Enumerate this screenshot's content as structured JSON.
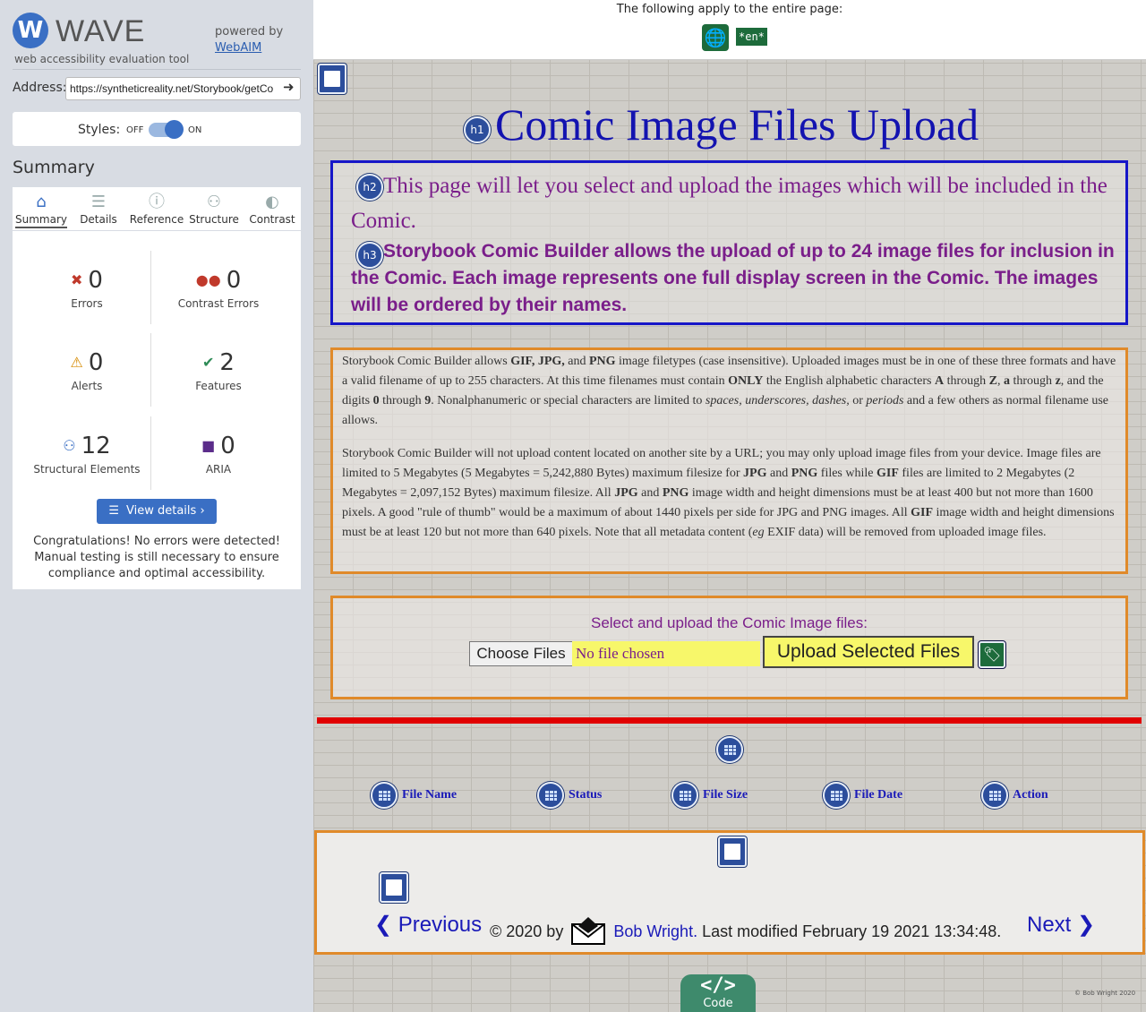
{
  "wave": {
    "logo_letter": "W",
    "logo_name": "WAVE",
    "tagline": "web accessibility evaluation tool",
    "powered_by": "powered by",
    "webaim": "WebAIM",
    "address_label": "Address:",
    "address_value": "https://syntheticreality.net/Storybook/getCo",
    "styles_label": "Styles:",
    "styles_off": "OFF",
    "styles_on": "ON",
    "styles_enabled": true,
    "summary_heading": "Summary",
    "tabs": [
      {
        "label": "Summary",
        "icon": "home-icon",
        "glyph": "⌂"
      },
      {
        "label": "Details",
        "icon": "list-icon",
        "glyph": "☰"
      },
      {
        "label": "Reference",
        "icon": "info-icon",
        "glyph": "ⓘ"
      },
      {
        "label": "Structure",
        "icon": "structure-icon",
        "glyph": "⚇"
      },
      {
        "label": "Contrast",
        "icon": "contrast-icon",
        "glyph": "◐"
      }
    ],
    "stats": {
      "errors": {
        "count": "0",
        "label": "Errors",
        "color": "#c0392b"
      },
      "contrast_errors": {
        "count": "0",
        "label": "Contrast Errors",
        "color": "#c0392b"
      },
      "alerts": {
        "count": "0",
        "label": "Alerts",
        "color": "#d68a00"
      },
      "features": {
        "count": "2",
        "label": "Features",
        "color": "#2e8b57"
      },
      "structural": {
        "count": "12",
        "label": "Structural Elements",
        "color": "#3a6fc4"
      },
      "aria": {
        "count": "0",
        "label": "ARIA",
        "color": "#5b2c8a"
      }
    },
    "view_details": "View details ›",
    "congrats": "Congratulations! No errors were detected! Manual testing is still necessary to ensure compliance and optimal accessibility."
  },
  "page": {
    "top_notice": "The following apply to the entire page:",
    "lang_badge": "*en*",
    "h1_badge": "h1",
    "h1": "Comic Image Files Upload",
    "h2_badge": "h2",
    "h2": "This page will let you select and upload the images which will be included in the Comic.",
    "h3_badge": "h3",
    "h3_pre": "Storybook Comic Builder allows the upload of up to ",
    "h3_num": "24",
    "h3_post": " image files for inclusion in the Comic. Each image represents one full display screen in the Comic. The images will be ordered by their names.",
    "para1": {
      "t1": "Storybook Comic Builder allows ",
      "b1": "GIF, JPG,",
      "t2": " and ",
      "b2": "PNG",
      "t3": " image filetypes (case insensitive). Uploaded images must be in one of these three formats and have a valid filename of up to 255 characters. At this time filenames must contain ",
      "b3": "ONLY",
      "t4": " the English alphabetic characters ",
      "b4": "A",
      "t5": " through ",
      "b5": "Z",
      "t6": ", ",
      "b6": "a",
      "t7": " through ",
      "b7": "z",
      "t8": ", and the digits ",
      "b8": "0",
      "t9": " through ",
      "b9": "9",
      "t10": ". Nonalphanumeric or special characters are limited to ",
      "i1": "spaces, underscores, dashes,",
      "t11": " or ",
      "i2": "periods",
      "t12": " and a few others as normal filename use allows."
    },
    "para2": {
      "t1": "Storybook Comic Builder will not upload content located on another site by a URL; you may only upload image files from your device. Image files are limited to 5 Megabytes (5 Megabytes = 5,242,880 Bytes) maximum filesize for ",
      "b1": "JPG",
      "t2": " and ",
      "b2": "PNG",
      "t3": " files while ",
      "b3": "GIF",
      "t4": " files are limited to 2 Megabytes (2 Megabytes = 2,097,152 Bytes) maximum filesize. All ",
      "b4": "JPG",
      "t5": " and ",
      "b5": "PNG",
      "t6": " image width and height dimensions must be at least 400 but not more than 1600 pixels. A good \"rule of thumb\" would be a maximum of about 1440 pixels per side for JPG and PNG images. All ",
      "b6": "GIF",
      "t7": " image width and height dimensions must be at least 120 but not more than 640 pixels. Note that all metadata content (",
      "i1": "eg",
      "t8": " EXIF data) will be removed from uploaded image files."
    },
    "upload_label": "Select and upload the Comic Image files:",
    "choose_files": "Choose Files",
    "no_file": "No file chosen",
    "upload_button": "Upload Selected Files",
    "table_headers": [
      "File Name",
      "Status",
      "File Size",
      "File Date",
      "Action"
    ],
    "prev": "❮ Previous",
    "next": "Next ❯",
    "copyright_pre": "© 2020 by",
    "author": "Bob Wright.",
    "modified": " Last modified February 19 2021 13:34:48.",
    "code_symbol": "</>",
    "code_label": "Code",
    "tiny_credit": "© Bob Wright 2020"
  }
}
